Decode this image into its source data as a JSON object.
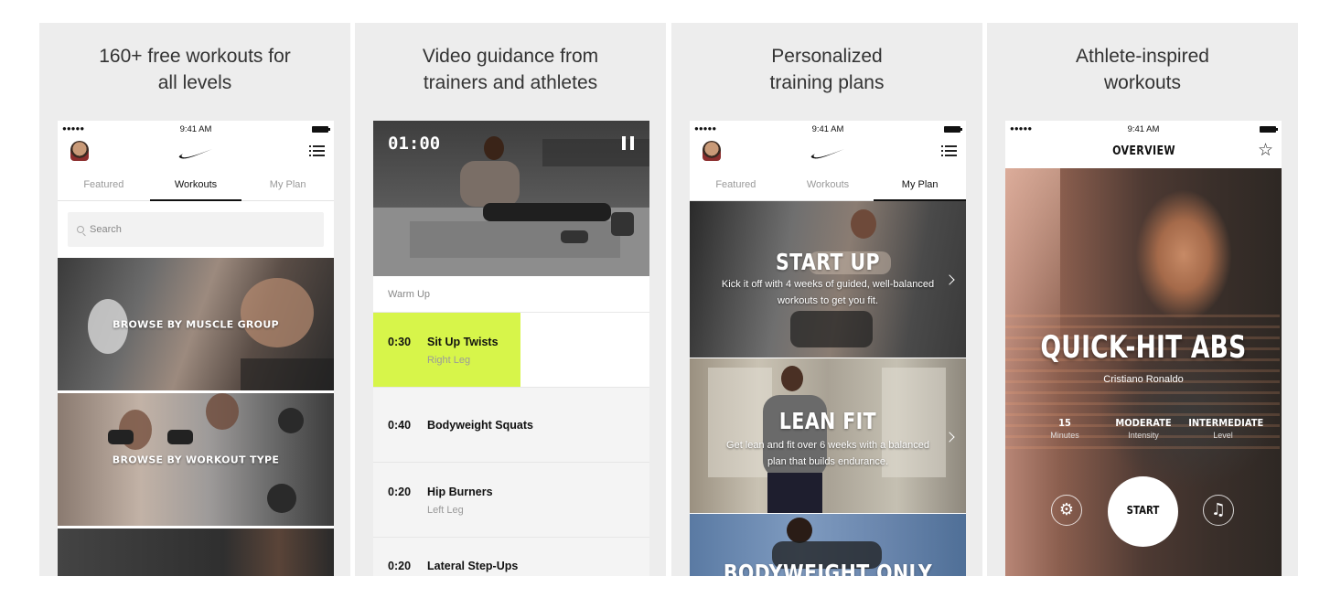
{
  "panels": [
    {
      "caption": [
        "160+ free workouts for",
        "all levels"
      ],
      "status": {
        "dots": "●●●●●",
        "time": "9:41 AM"
      },
      "tabs": [
        "Featured",
        "Workouts",
        "My Plan"
      ],
      "active_tab": "Workouts",
      "search": {
        "placeholder": "Search"
      },
      "tiles": [
        "BROWSE BY MUSCLE GROUP",
        "BROWSE BY WORKOUT TYPE"
      ]
    },
    {
      "caption": [
        "Video guidance from",
        "trainers and athletes"
      ],
      "video": {
        "timer": "01:00"
      },
      "section": "Warm Up",
      "exercises": [
        {
          "time": "0:30",
          "name": "Sit Up Twists",
          "sub": "Right Leg"
        },
        {
          "time": "0:40",
          "name": "Bodyweight Squats",
          "sub": ""
        },
        {
          "time": "0:20",
          "name": "Hip Burners",
          "sub": "Left Leg"
        },
        {
          "time": "0:20",
          "name": "Lateral Step-Ups",
          "sub": ""
        }
      ],
      "highlight_color": "#d7f54a"
    },
    {
      "caption": [
        "Personalized",
        "training plans"
      ],
      "status": {
        "dots": "●●●●●",
        "time": "9:41 AM"
      },
      "tabs": [
        "Featured",
        "Workouts",
        "My Plan"
      ],
      "active_tab": "My Plan",
      "plans": [
        {
          "title": "START UP",
          "desc": "Kick it off with 4 weeks of guided, well-balanced workouts to get you fit."
        },
        {
          "title": "LEAN FIT",
          "desc": "Get lean and fit over 6 weeks with a balanced plan that builds endurance."
        },
        {
          "title": "BODYWEIGHT ONLY",
          "desc": ""
        }
      ]
    },
    {
      "caption": [
        "Athlete-inspired",
        "workouts"
      ],
      "status": {
        "dots": "●●●●●",
        "time": "9:41 AM"
      },
      "header": "OVERVIEW",
      "workout": {
        "title": "QUICK-HIT ABS",
        "athlete": "Cristiano Ronaldo",
        "stats": [
          {
            "value": "15",
            "label": "Minutes"
          },
          {
            "value": "MODERATE",
            "label": "Intensity"
          },
          {
            "value": "INTERMEDIATE",
            "label": "Level"
          }
        ],
        "start_label": "START"
      }
    }
  ],
  "icons": [
    "signal-dots-icon",
    "battery-icon",
    "avatar",
    "nike-swoosh-icon",
    "list-icon",
    "search-icon",
    "pause-icon",
    "chevron-right-icon",
    "star-icon",
    "gear-icon",
    "music-note-icon"
  ]
}
